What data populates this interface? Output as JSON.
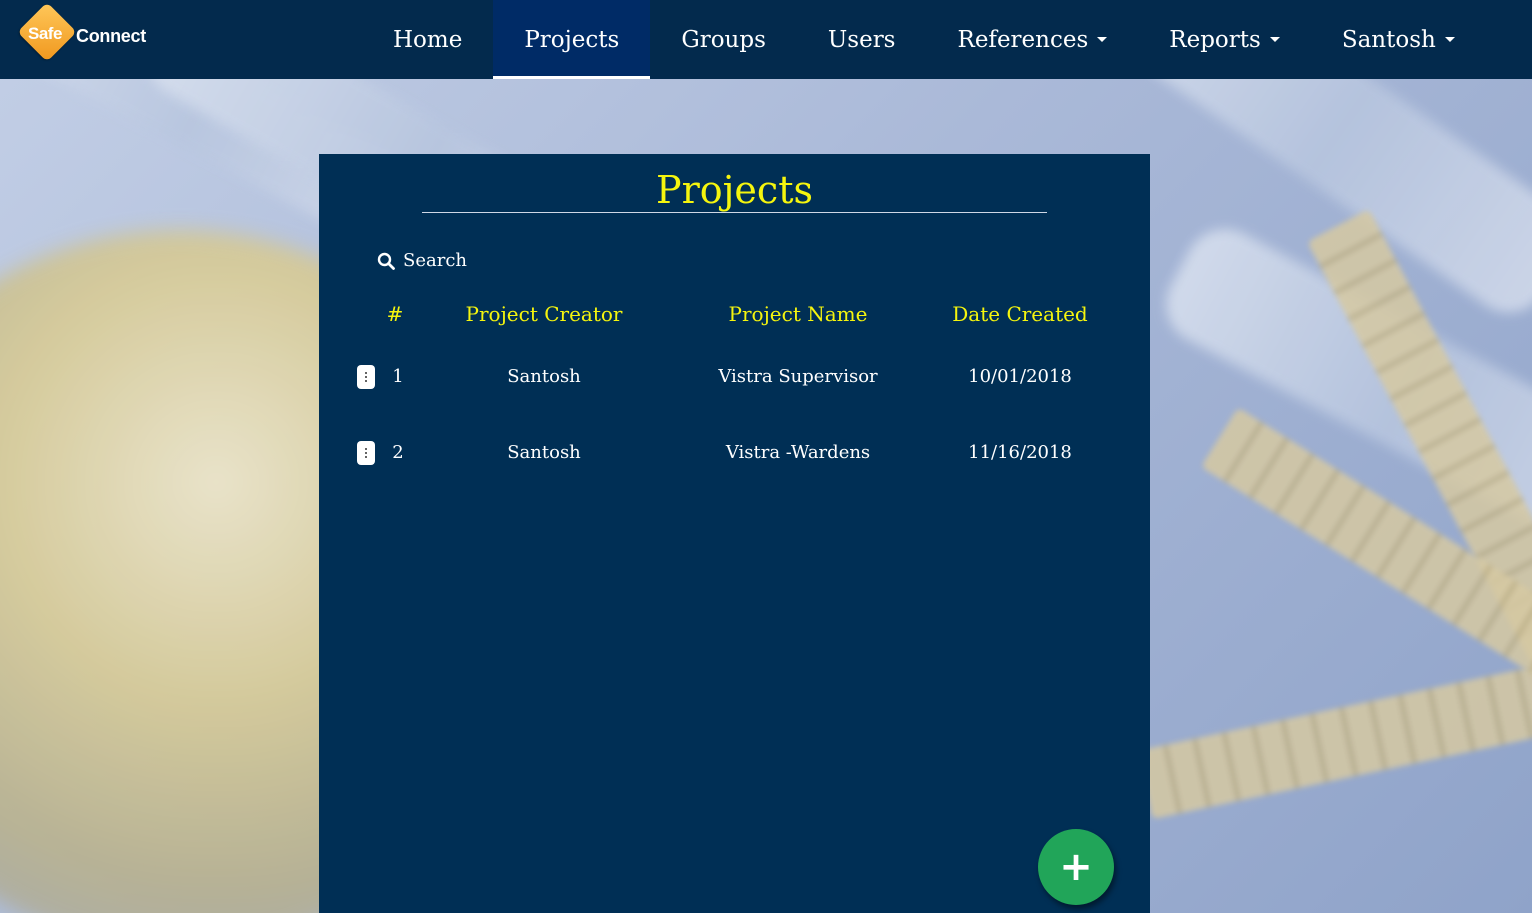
{
  "brand": {
    "logo_word1": "Safe",
    "logo_word2": "Connect"
  },
  "nav": {
    "items": [
      {
        "label": "Home",
        "active": false,
        "dropdown": false
      },
      {
        "label": "Projects",
        "active": true,
        "dropdown": false
      },
      {
        "label": "Groups",
        "active": false,
        "dropdown": false
      },
      {
        "label": "Users",
        "active": false,
        "dropdown": false
      },
      {
        "label": "References",
        "active": false,
        "dropdown": true
      },
      {
        "label": "Reports",
        "active": false,
        "dropdown": true
      },
      {
        "label": "Santosh",
        "active": false,
        "dropdown": true
      }
    ]
  },
  "panel": {
    "title": "Projects",
    "search_label": "Search",
    "columns": [
      "#",
      "Project Creator",
      "Project Name",
      "Date Created"
    ],
    "rows": [
      {
        "num": "1",
        "creator": "Santosh",
        "name": "Vistra Supervisor",
        "date": "10/01/2018"
      },
      {
        "num": "2",
        "creator": "Santosh",
        "name": "Vistra -Wardens",
        "date": "11/16/2018"
      }
    ],
    "add_button": "+"
  },
  "colors": {
    "navbar": "#032a4d",
    "nav_active": "#002b66",
    "panel": "#002f55",
    "accent_yellow": "#f5f50e",
    "fab_green": "#21a559",
    "logo_orange": "#f0971e"
  },
  "icons": {
    "search": "search-icon",
    "row_menu": "more-vertical-icon",
    "dropdown": "caret-down-icon",
    "add": "plus-icon"
  }
}
